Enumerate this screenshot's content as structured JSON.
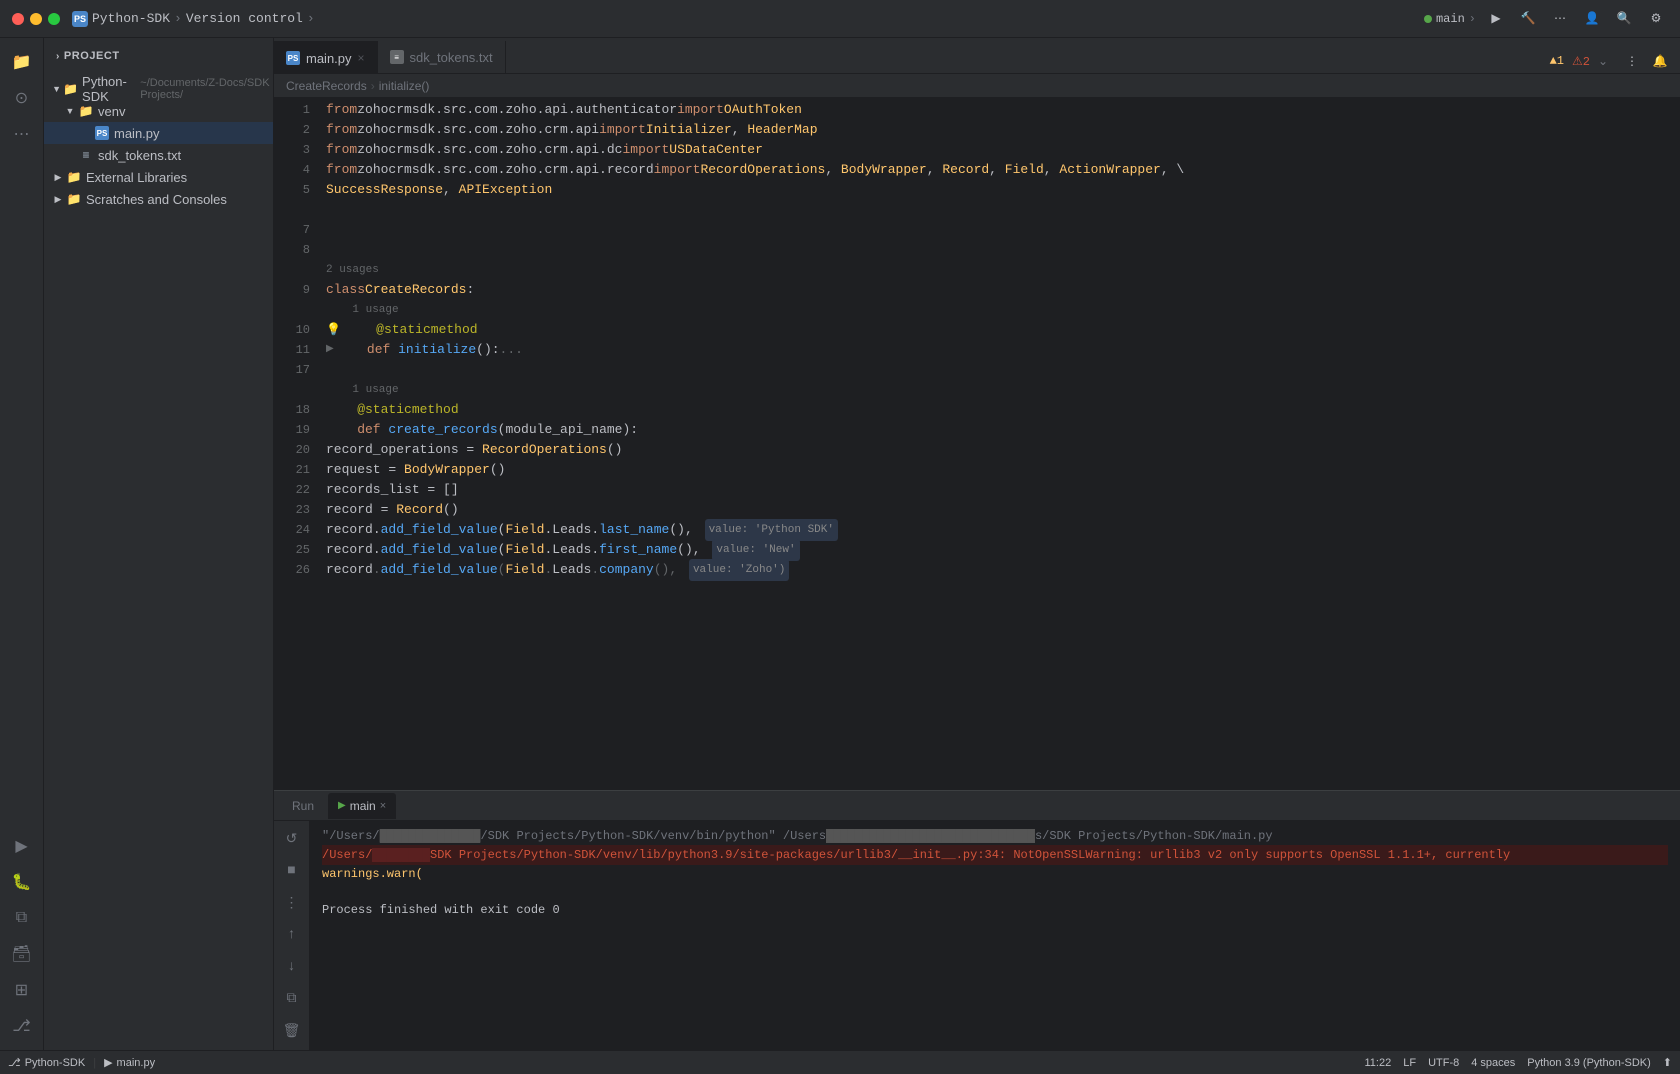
{
  "titleBar": {
    "projectName": "Python-SDK",
    "projectPath": "~/Documents/Z-Docs/SDK Projects/",
    "versionControl": "Version control",
    "runConfig": "main",
    "py_label": "PS"
  },
  "sidebar": {
    "header": "Project",
    "items": [
      {
        "label": "Python-SDK",
        "path": "~/Documents/Z-Docs/SDK Projects/",
        "type": "root",
        "expanded": true
      },
      {
        "label": "venv",
        "type": "folder",
        "expanded": true
      },
      {
        "label": "main.py",
        "type": "py",
        "selected": true
      },
      {
        "label": "sdk_tokens.txt",
        "type": "txt"
      },
      {
        "label": "External Libraries",
        "type": "folder",
        "expanded": false
      },
      {
        "label": "Scratches and Consoles",
        "type": "scratch"
      }
    ]
  },
  "tabs": [
    {
      "label": "main.py",
      "type": "py",
      "active": true
    },
    {
      "label": "sdk_tokens.txt",
      "type": "txt",
      "active": false
    }
  ],
  "codeLines": [
    {
      "num": 1,
      "content": "from zohocrmsdk.src.com.zoho.api.authenticator import OAuthToken"
    },
    {
      "num": 2,
      "content": "from zohocrmsdk.src.com.zoho.crm.api import Initializer, HeaderMap"
    },
    {
      "num": 3,
      "content": "from zohocrmsdk.src.com.zoho.crm.api.dc import USDataCenter"
    },
    {
      "num": 4,
      "content": "from zohocrmsdk.src.com.zoho.crm.api.record import RecordOperations, BodyWrapper, Record, Field, ActionWrapper, \\"
    },
    {
      "num": 5,
      "content": "    SuccessResponse, APIException"
    },
    {
      "num": "",
      "content": ""
    },
    {
      "num": 7,
      "content": ""
    },
    {
      "num": 8,
      "content": ""
    },
    {
      "num": "usage",
      "content": "2 usages"
    },
    {
      "num": 9,
      "content": "class CreateRecords:"
    },
    {
      "num": "usage2",
      "content": "1 usage"
    },
    {
      "num": 10,
      "content": "    @staticmethod",
      "bulb": true
    },
    {
      "num": 11,
      "content": "    def initialize():...",
      "folded": true
    },
    {
      "num": 17,
      "content": ""
    },
    {
      "num": "usage3",
      "content": "1 usage"
    },
    {
      "num": 18,
      "content": "    @staticmethod"
    },
    {
      "num": 19,
      "content": "    def create_records(module_api_name):"
    },
    {
      "num": 20,
      "content": "        record_operations = RecordOperations()"
    },
    {
      "num": 21,
      "content": "        request = BodyWrapper()"
    },
    {
      "num": 22,
      "content": "        records_list = []"
    },
    {
      "num": 23,
      "content": "        record = Record()"
    },
    {
      "num": 24,
      "content": "        record.add_field_value(Field.Leads.last_name(),",
      "hint": "value: 'Python SDK'"
    },
    {
      "num": 25,
      "content": "        record.add_field_value(Field.Leads.first_name(),",
      "hint": "value: 'New'"
    },
    {
      "num": 26,
      "content": "        record.add_field_value(Field.Leads.company(),",
      "hint": "value: 'Zoho')"
    }
  ],
  "breadcrumb": {
    "parts": [
      "CreateRecords",
      "initialize()"
    ]
  },
  "bottomPanel": {
    "tabs": [
      {
        "label": "Run",
        "active": false
      },
      {
        "label": "main",
        "active": true,
        "closeable": true
      }
    ],
    "consoleLines": [
      {
        "type": "path",
        "content": "\"/Users/████████████████/SDK Projects/Python-SDK/venv/bin/python\" /Users██████████████████████████████s/SDK Projects/Python-SDK/main.py"
      },
      {
        "type": "error",
        "content": "/Users/████████SDK Projects/Python-SDK/venv/lib/python3.9/site-packages/urllib3/__init__.py:34: NotOpenSSLWarning: urllib3 v2 only supports OpenSSL 1.1.1+, currently"
      },
      {
        "type": "warning",
        "content": "  warnings.warn("
      },
      {
        "type": "normal",
        "content": ""
      },
      {
        "type": "success",
        "content": "Process finished with exit code 0"
      }
    ]
  },
  "statusBar": {
    "gitBranch": "Python-SDK",
    "currentFile": "main.py",
    "position": "11:22",
    "lineEnding": "LF",
    "encoding": "UTF-8",
    "indent": "4 spaces",
    "pythonVersion": "Python 3.9 (Python-SDK)"
  },
  "icons": {
    "folder": "📁",
    "py": "PS",
    "txt": "≡",
    "search": "🔍",
    "gear": "⚙",
    "run": "▶",
    "stop": "■",
    "build": "🔨",
    "debug": "🐛",
    "git": "⎇",
    "refresh": "↺",
    "up": "↑",
    "down": "↓",
    "more": "⋯",
    "bell": "🔔",
    "user": "👤",
    "close": "×",
    "chevron_right": "›",
    "chevron_down": "⌄",
    "expand": "⊞",
    "collapse": "⊟"
  },
  "warningCount": "▲1",
  "errorCount": "⚠2"
}
